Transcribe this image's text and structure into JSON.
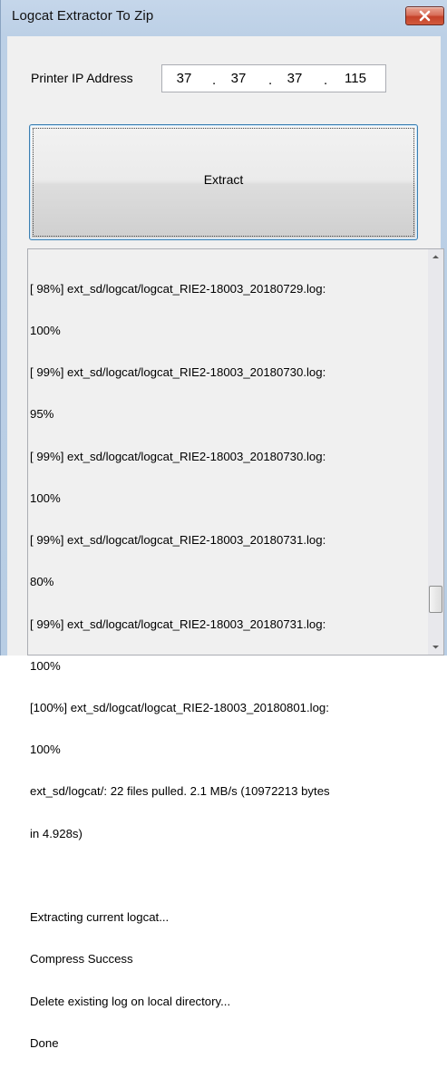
{
  "window": {
    "title": "Logcat Extractor To Zip",
    "close_icon": "close-icon"
  },
  "form": {
    "ip_label": "Printer IP Address",
    "ip_octets": [
      "37",
      "37",
      "37",
      "115"
    ],
    "ip_separator": ".",
    "extract_label": "Extract"
  },
  "log": {
    "lines": [
      "[ 98%] ext_sd/logcat/logcat_RIE2-18003_20180729.log:",
      "100%",
      "[ 99%] ext_sd/logcat/logcat_RIE2-18003_20180730.log:",
      "95%",
      "[ 99%] ext_sd/logcat/logcat_RIE2-18003_20180730.log:",
      "100%",
      "[ 99%] ext_sd/logcat/logcat_RIE2-18003_20180731.log:",
      "80%",
      "[ 99%] ext_sd/logcat/logcat_RIE2-18003_20180731.log:",
      "100%",
      "[100%] ext_sd/logcat/logcat_RIE2-18003_20180801.log:",
      "100%",
      "ext_sd/logcat/: 22 files pulled. 2.1 MB/s (10972213 bytes",
      "in 4.928s)",
      "",
      "Extracting current logcat...",
      "Compress Success",
      "Delete existing log on local directory...",
      "Done"
    ],
    "scroll_up_icon": "triangle-up-icon",
    "scroll_down_icon": "triangle-down-icon"
  },
  "colors": {
    "title_bar": "#bcd0e6",
    "close_button": "#c5412a",
    "client_background": "#f0f0f0",
    "button_focus_border": "#3c7fb1"
  }
}
